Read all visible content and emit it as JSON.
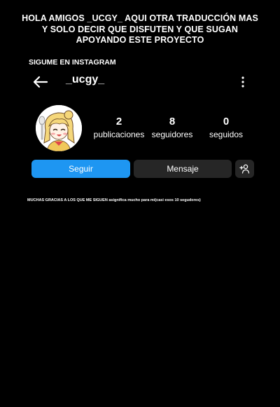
{
  "banner": {
    "line1": "HOLA AMIGOS _UCGY_ AQUI OTRA TRADUCCIÓN MAS",
    "line2": "Y SOLO DECIR QUE DISFUTEN Y QUE SUGAN",
    "line3": "APOYANDO ESTE PROYECTO"
  },
  "follow_ig": "SIGUME EN INSTAGRAM",
  "header": {
    "username": "_ucgy_",
    "back_icon": "arrow-left-icon",
    "more_icon": "more-vertical-icon"
  },
  "profile": {
    "avatar": "anime-girl-avatar",
    "stats": [
      {
        "value": "2",
        "label": "publicaciones"
      },
      {
        "value": "8",
        "label": "seguidores"
      },
      {
        "value": "0",
        "label": "seguidos"
      }
    ]
  },
  "buttons": {
    "follow": "Seguir",
    "message": "Mensaje",
    "add_user_icon": "add-person-icon"
  },
  "thanks_text": "MUCHAS GRACIAS A LOS QUE ME SIGUEN asignifica mucho para mi(casi esos 10 segudores)",
  "colors": {
    "background": "#000000",
    "follow_button": "#1e96f2",
    "secondary_button": "#262626",
    "text": "#ffffff"
  }
}
